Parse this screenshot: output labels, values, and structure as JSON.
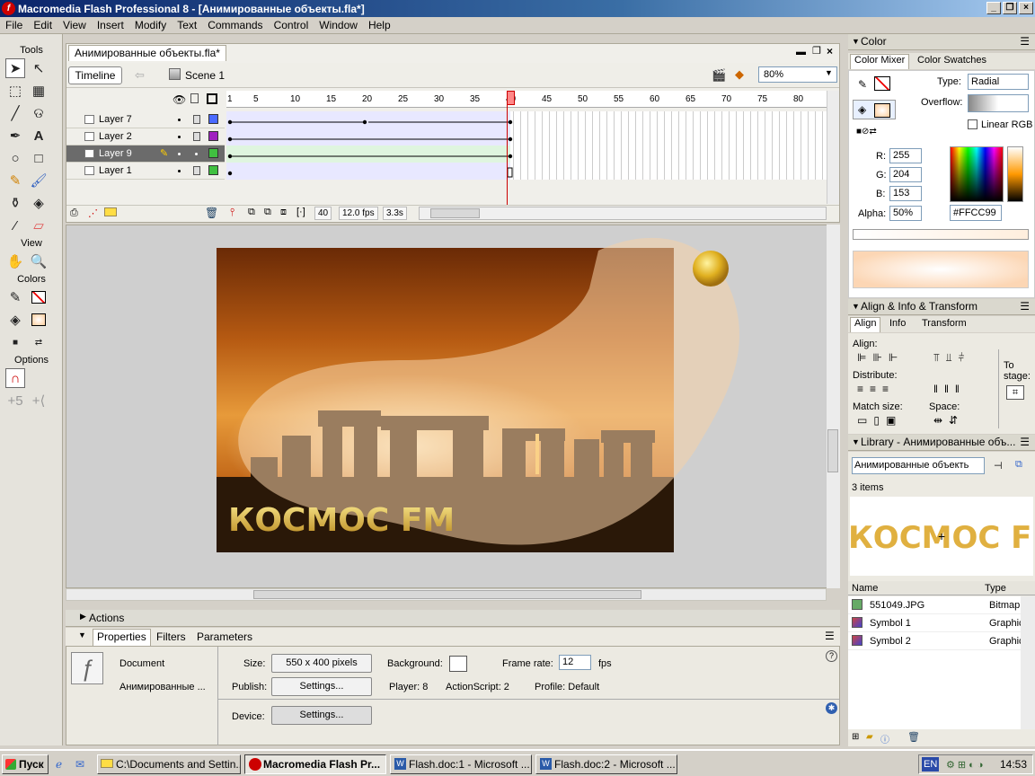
{
  "window": {
    "title": "Macromedia Flash Professional 8 - [Анимированные объекты.fla*]",
    "app_icon": "f"
  },
  "menu": [
    "File",
    "Edit",
    "View",
    "Insert",
    "Modify",
    "Text",
    "Commands",
    "Control",
    "Window",
    "Help"
  ],
  "tools": {
    "section_tools": "Tools",
    "section_view": "View",
    "section_colors": "Colors",
    "section_options": "Options"
  },
  "document": {
    "tab": "Анимированные объекты.fla*",
    "timeline_button": "Timeline",
    "scene": "Scene 1",
    "zoom": "80%"
  },
  "layers": [
    {
      "name": "Layer 7",
      "color": "#4a6aff"
    },
    {
      "name": "Layer 2",
      "color": "#a020c0"
    },
    {
      "name": "Layer 9",
      "color": "#40c040",
      "selected": true
    },
    {
      "name": "Layer 1",
      "color": "#40c040"
    }
  ],
  "ruler": [
    "1",
    "5",
    "10",
    "15",
    "20",
    "25",
    "30",
    "35",
    "40",
    "45",
    "50",
    "55",
    "60",
    "65",
    "70",
    "75",
    "80"
  ],
  "timeline_status": {
    "frame": "40",
    "fps": "12.0 fps",
    "time": "3.3s"
  },
  "stage": {
    "banner_text": "КОСМОС FM"
  },
  "panels": {
    "actions": "Actions",
    "tabs": [
      "Properties",
      "Filters",
      "Parameters"
    ]
  },
  "properties": {
    "type": "Document",
    "name": "Анимированные ...",
    "size_label": "Size:",
    "size_value": "550 x 400 pixels",
    "background_label": "Background:",
    "frame_rate_label": "Frame rate:",
    "frame_rate": "12",
    "fps": "fps",
    "publish_label": "Publish:",
    "settings": "Settings...",
    "player": "Player: 8",
    "actionscript": "ActionScript: 2",
    "profile": "Profile: Default",
    "device_label": "Device:"
  },
  "color": {
    "title": "Color",
    "tab_mixer": "Color Mixer",
    "tab_swatches": "Color Swatches",
    "type_label": "Type:",
    "type_value": "Radial",
    "overflow_label": "Overflow:",
    "linear_rgb": "Linear RGB",
    "r_label": "R:",
    "r": "255",
    "g_label": "G:",
    "g": "204",
    "b_label": "B:",
    "b": "153",
    "alpha_label": "Alpha:",
    "alpha": "50%",
    "hex": "#FFCC99"
  },
  "align": {
    "title": "Align & Info & Transform",
    "tabs": [
      "Align",
      "Info",
      "Transform"
    ],
    "align_label": "Align:",
    "distribute_label": "Distribute:",
    "match_label": "Match size:",
    "space_label": "Space:",
    "to_stage": "To stage:"
  },
  "library": {
    "title": "Library - Анимированные объ...",
    "doc": "Анимированные объекть",
    "count": "3 items",
    "preview": "КОСМОС FM",
    "col_name": "Name",
    "col_type": "Type",
    "items": [
      {
        "name": "551049.JPG",
        "type": "Bitmap"
      },
      {
        "name": "Symbol 1",
        "type": "Graphic"
      },
      {
        "name": "Symbol 2",
        "type": "Graphic"
      }
    ]
  },
  "taskbar": {
    "start": "Пуск",
    "tasks": [
      "C:\\Documents and Settin...",
      "Macromedia Flash Pr...",
      "Flash.doc:1 - Microsoft ...",
      "Flash.doc:2 - Microsoft ..."
    ],
    "lang": "EN",
    "clock": "14:53"
  }
}
